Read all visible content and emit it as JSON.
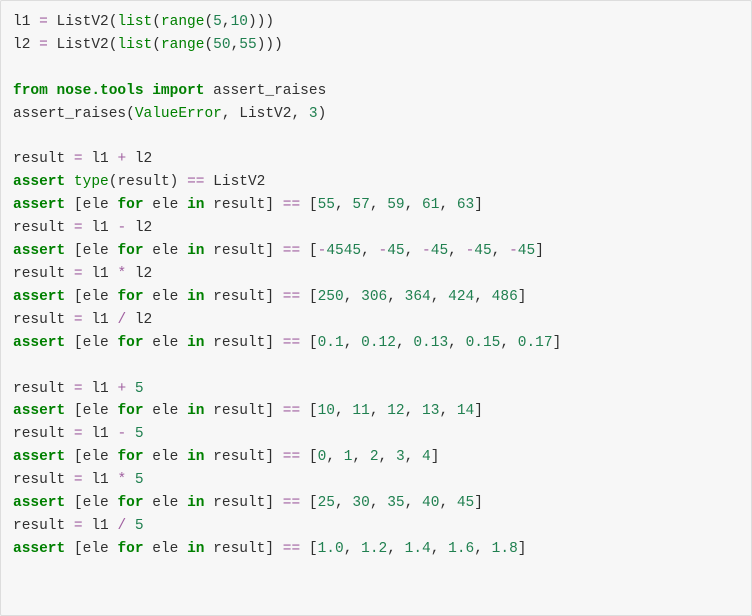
{
  "code": {
    "l1_var": "l1",
    "l2_var": "l2",
    "eq": " = ",
    "listv2": "ListV2",
    "list_fn": "list",
    "range_fn": "range",
    "lp": "(",
    "rp": ")",
    "comma": ",",
    "cs": ", ",
    "lb": "[",
    "rb": "]",
    "dot": ".",
    "five": "5",
    "ten": "10",
    "fifty": "50",
    "fiftyfive": "55",
    "from_kw": "from",
    "import_kw": "import",
    "nose": "nose.tools",
    "assert_raises": "assert_raises",
    "valueerror": "ValueError",
    "three": "3",
    "result": "result",
    "plus": "+",
    "minus": "-",
    "star": "*",
    "slash": "/",
    "assert_kw": "assert",
    "type_fn": "type",
    "eqeq": "==",
    "ele": "ele",
    "for_kw": "for",
    "in_kw": "in",
    "scalar_five": "5",
    "v55": "55",
    "v57": "57",
    "v59": "59",
    "v61": "61",
    "v63": "63",
    "vn45": "-45",
    "v250": "250",
    "v306": "306",
    "v364": "364",
    "v424": "424",
    "v486": "486",
    "v010": "0.1",
    "v012": "0.12",
    "v013": "0.13",
    "v015": "0.15",
    "v017": "0.17",
    "v10": "10",
    "v11": "11",
    "v12": "12",
    "v13": "13",
    "v14": "14",
    "v0": "0",
    "v1": "1",
    "v2": "2",
    "v3": "3",
    "v4": "4",
    "v25": "25",
    "v30": "30",
    "v35": "35",
    "v40": "40",
    "v45": "45",
    "v1_0": "1.0",
    "v1_2": "1.2",
    "v1_4": "1.4",
    "v1_6": "1.6",
    "v1_8": "1.8"
  }
}
